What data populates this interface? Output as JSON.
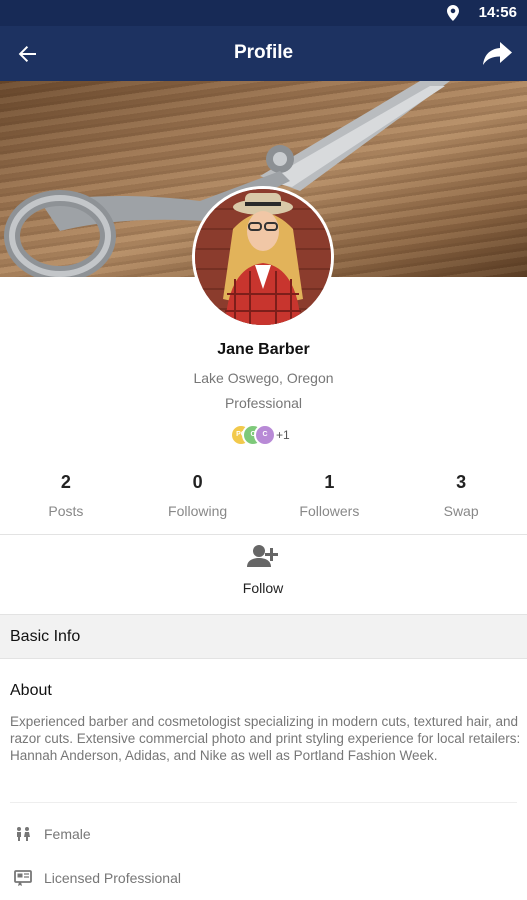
{
  "status_bar": {
    "time": "14:56",
    "location_icon": "location-pin-icon"
  },
  "app_bar": {
    "title": "Profile",
    "back_icon": "back-arrow-icon",
    "share_icon": "share-icon"
  },
  "profile": {
    "name": "Jane Barber",
    "location": "Lake Oswego, Oregon",
    "role": "Professional",
    "badges": [
      {
        "label": "PC",
        "color": "#f2c94c"
      },
      {
        "label": "C",
        "color": "#7ec97a"
      },
      {
        "label": "C",
        "color": "#b88ad6"
      }
    ],
    "badges_more": "+1"
  },
  "stats": [
    {
      "value": "2",
      "label": "Posts"
    },
    {
      "value": "0",
      "label": "Following"
    },
    {
      "value": "1",
      "label": "Followers"
    },
    {
      "value": "3",
      "label": "Swap"
    }
  ],
  "follow": {
    "label": "Follow",
    "icon": "add-person-icon"
  },
  "basic_info": {
    "header": "Basic Info",
    "about_title": "About",
    "about_text": "Experienced barber and cosmetologist specializing in modern cuts, textured hair, and  razor cuts. Extensive commercial photo and print styling experience for local retailers: Hannah Anderson, Adidas, and Nike as well as Portland Fashion Week.",
    "details": [
      {
        "icon": "gender-icon",
        "text": "Female"
      },
      {
        "icon": "license-icon",
        "text": "Licensed Professional"
      }
    ]
  },
  "colors": {
    "app_bar": "#1d3261",
    "status_bar": "#172a56"
  }
}
